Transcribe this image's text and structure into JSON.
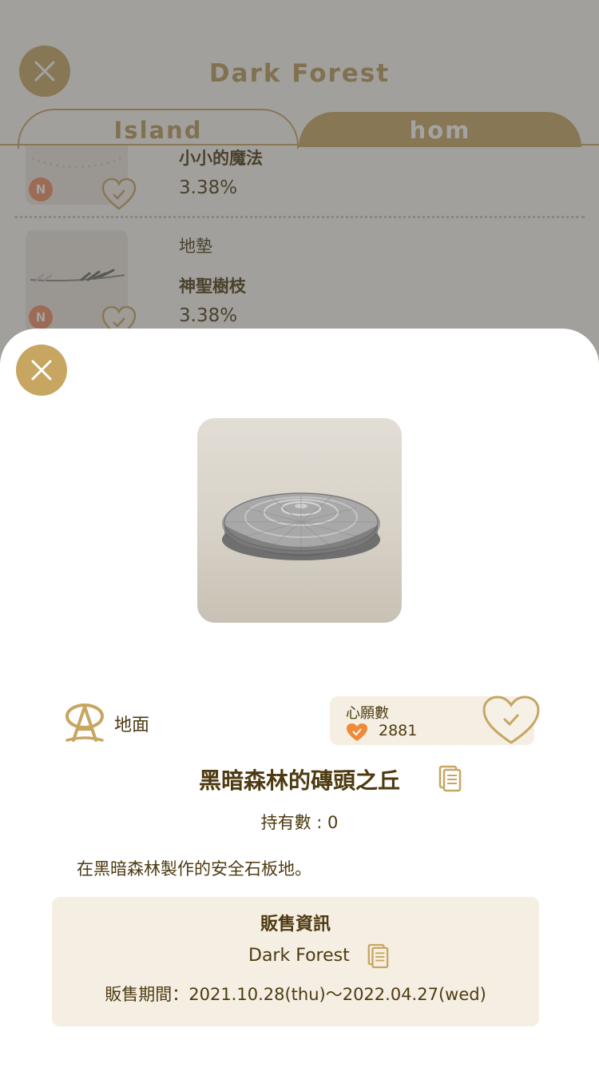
{
  "background": {
    "title": "Dark Forest",
    "tabs": [
      {
        "label": "Island",
        "active": true
      },
      {
        "label": "hom",
        "active": false
      }
    ],
    "items": [
      {
        "category": "",
        "name": "小小的魔法",
        "percent": "3.38%",
        "badge": "N"
      },
      {
        "category": "地墊",
        "name": "神聖樹枝",
        "percent": "3.38%",
        "badge": "N"
      }
    ]
  },
  "sheet": {
    "category_icon": "floor-rug-icon",
    "category": "地面",
    "wishlist": {
      "label": "心願數",
      "count": "2881"
    },
    "item_name": "黑暗森林的磚頭之丘",
    "owned": "持有數 : 0",
    "description": "在黑暗森林製作的安全石板地。",
    "sale": {
      "title": "販售資訊",
      "shop": "Dark Forest",
      "period": "販售期間：2021.10.28(thu)〜2022.04.27(wed)"
    }
  },
  "colors": {
    "gold": "#c7a662",
    "text_brown": "#4d3a10",
    "panel_beige": "#f5efe3",
    "badge_orange": "#f28c63",
    "heart_orange": "#f08a3a"
  }
}
